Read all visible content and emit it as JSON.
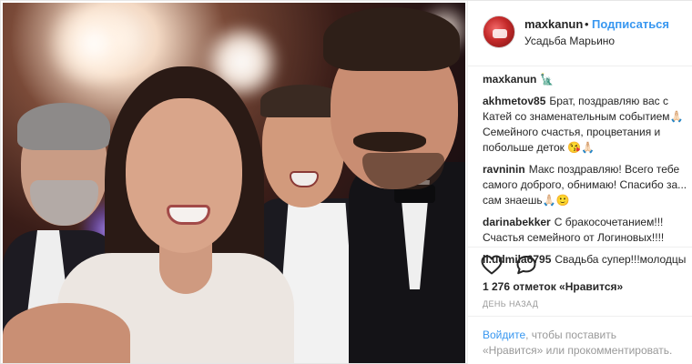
{
  "post": {
    "username": "maxkanun",
    "separator": "•",
    "follow_label": "Подписаться",
    "location": "Усадьба Марьино",
    "caption_username": "maxkanun",
    "caption_text": "🗽",
    "comments": [
      {
        "user": "akhmetov85",
        "text": "Брат, поздравляю вас с Катей со знаменательным событием🙏🏻 Семейного счастья, процветания и побольше деток 😘🙏🏻"
      },
      {
        "user": "ravninin",
        "text": "Макс поздравляю! Всего тебе самого доброго, обнимаю! Спасибо за... сам знаешь🙏🏻🙂"
      },
      {
        "user": "darinabekker",
        "text": "С бракосочетанием!!! Счастья семейного от Логиновых!!!!"
      },
      {
        "user": "li.udmila6795",
        "text": "Свадьба супер!!!молодцы"
      }
    ],
    "likes_text": "1 276 отметок «Нравится»",
    "time_text": "ДЕНЬ НАЗАД",
    "login_link": "Войдите",
    "login_text": ", чтобы поставить «Нравится» или прокомментировать."
  },
  "icons": {
    "like": "heart-outline-icon",
    "comment": "speech-bubble-icon"
  },
  "colors": {
    "link": "#3897f0",
    "text": "#262626",
    "muted": "#999999"
  }
}
